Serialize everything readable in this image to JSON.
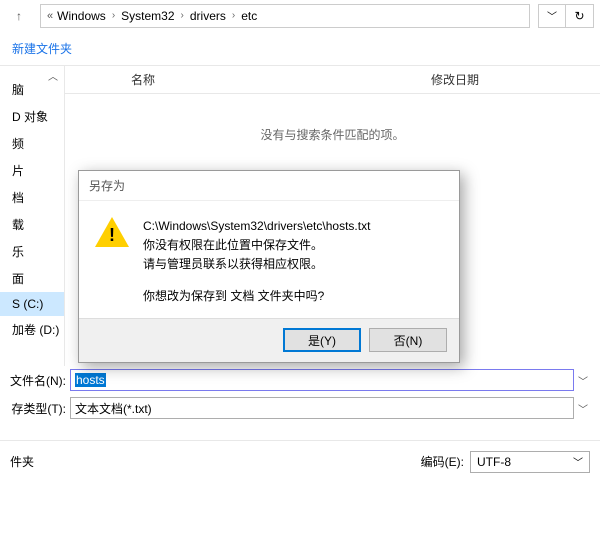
{
  "address": {
    "crumbs": [
      "Windows",
      "System32",
      "drivers",
      "etc"
    ],
    "prefix": "«"
  },
  "toolbar": {
    "new_folder": "新建文件夹"
  },
  "sidebar": {
    "items": [
      "脑",
      "D 对象",
      "频",
      "片",
      "档",
      "载",
      "乐",
      "面",
      "S (C:)",
      "加卷 (D:)"
    ],
    "selected_index": 8
  },
  "columns": {
    "name": "名称",
    "modified": "修改日期"
  },
  "content": {
    "empty": "没有与搜索条件匹配的项。"
  },
  "filename_row": {
    "label": "文件名(N):",
    "value": "hosts"
  },
  "filetype_row": {
    "label": "存类型(T):",
    "value": "文本文档(*.txt)"
  },
  "bottom": {
    "folder": "件夹",
    "encoding_label": "编码(E):",
    "encoding_value": "UTF-8"
  },
  "dialog": {
    "title": "另存为",
    "line1": "C:\\Windows\\System32\\drivers\\etc\\hosts.txt",
    "line2": "你没有权限在此位置中保存文件。",
    "line3": "请与管理员联系以获得相应权限。",
    "line4": "你想改为保存到 文档 文件夹中吗?",
    "yes": "是(Y)",
    "no": "否(N)"
  }
}
